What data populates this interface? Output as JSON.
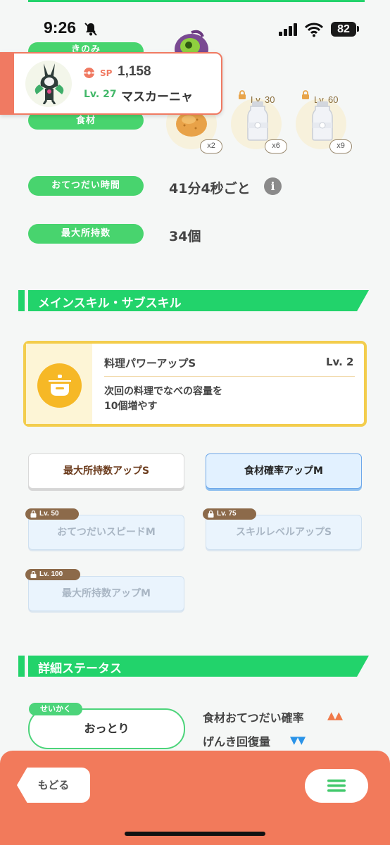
{
  "status": {
    "time": "9:26",
    "battery": "82"
  },
  "monster": {
    "sp_label": "SP",
    "sp_value": "1,158",
    "level": "Lv. 27",
    "name": "マスカーニャ"
  },
  "pills": {
    "berry": "きのみ",
    "ingredients": "食材",
    "help_time": "おてつだい時間",
    "max_carry": "最大所持数"
  },
  "ingredients": [
    {
      "name": "potato",
      "count": "x2",
      "level": ""
    },
    {
      "name": "milk",
      "count": "x6",
      "level": "Lv. 30"
    },
    {
      "name": "milk",
      "count": "x9",
      "level": "Lv. 60"
    }
  ],
  "info": {
    "help_time": "41分4秒ごと",
    "info_icon": "i",
    "max_carry": "34個"
  },
  "sections": {
    "skills": "メインスキル・サブスキル",
    "details": "詳細ステータス"
  },
  "main_skill": {
    "name": "料理パワーアップS",
    "level": "Lv. 2",
    "desc_line1": "次回の料理でなべの容量を",
    "desc_line2": "10個増やす"
  },
  "sub_skills": [
    {
      "label": "最大所持数アップS",
      "lock": "",
      "state": "active"
    },
    {
      "label": "食材確率アップM",
      "lock": "",
      "state": "selected"
    },
    {
      "label": "おてつだいスピードM",
      "lock": "Lv. 50",
      "state": "locked"
    },
    {
      "label": "スキルレベルアップS",
      "lock": "Lv. 75",
      "state": "locked"
    },
    {
      "label": "最大所持数アップM",
      "lock": "Lv. 100",
      "state": "locked"
    }
  ],
  "nature": {
    "tag": "せいかく",
    "name": "おっとり",
    "up_label": "食材おてつだい確率",
    "up_arrows": "▲▲",
    "down_label": "げんき回復量",
    "down_arrows": "▼▼"
  },
  "nav": {
    "back": "もどる",
    "menu_icon": "menu-icon"
  },
  "colors": {
    "accent_green": "#22d36b",
    "orange": "#f27a5b",
    "skill_yellow": "#f6b826"
  }
}
